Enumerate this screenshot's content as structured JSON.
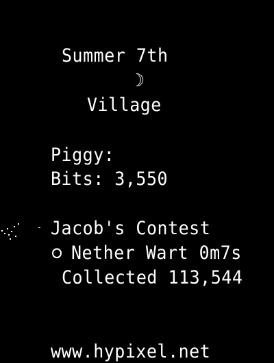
{
  "scoreboard": {
    "date": "Summer 7th",
    "moon_icon": "moon-icon",
    "moon_glyph": "☽",
    "location": "Village",
    "purse_label": "Piggy:",
    "bits_text": "Bits: 3,550",
    "contest_title": "Jacob's Contest",
    "crop_text": "Nether Wart 0m7s",
    "collected_text": "Collected 113,544",
    "footer_url": "www.hypixel.net"
  },
  "colors": {
    "background": "#000000",
    "text": "#ffffff"
  }
}
